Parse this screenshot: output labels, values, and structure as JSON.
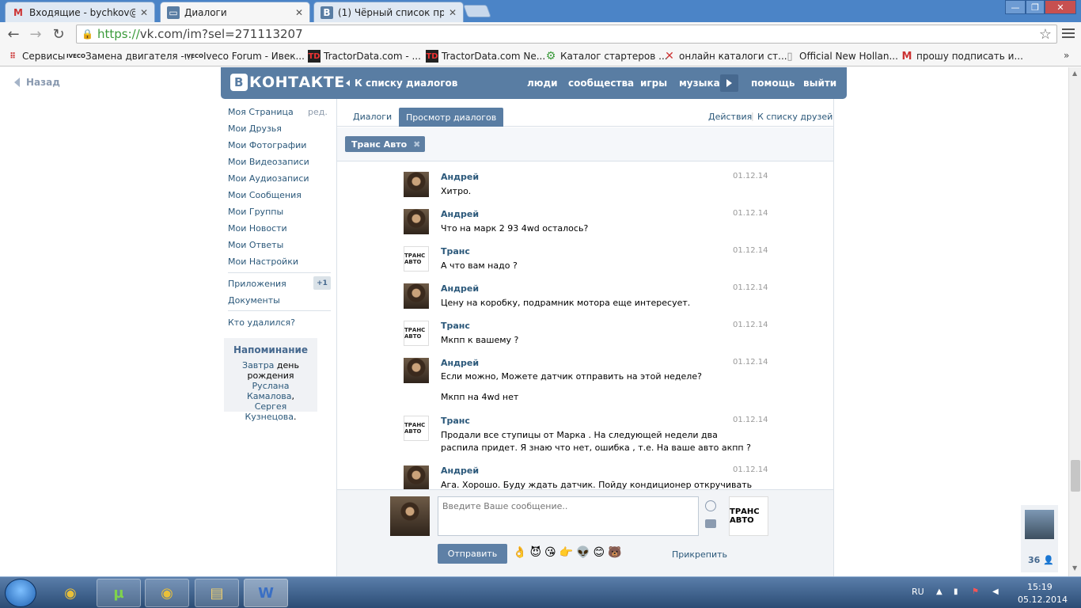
{
  "browser": {
    "tabs": [
      {
        "icon": "gmail-icon",
        "title": "Входящие - bychkov@spe"
      },
      {
        "icon": "vk-dialog-icon",
        "title": "Диалоги"
      },
      {
        "icon": "vk-icon",
        "title": "(1) Чёрный список прод"
      }
    ],
    "window_buttons": {
      "minimize": "—",
      "restore": "❐",
      "close": "✕"
    },
    "url_scheme": "https://",
    "url_rest": "vk.com/im?sel=271113207",
    "bookmarks": [
      "Сервисы",
      "Замена двигателя -...",
      "Iveco Forum - Ивек...",
      "TractorData.com - ...",
      "TractorData.com Ne...",
      "Каталог стартеров ...",
      "онлайн каталоги ст...",
      "Official New Hollan...",
      "прошу подписать и..."
    ],
    "bookmarks_more": "»"
  },
  "page": {
    "back_label": "Назад",
    "vk": {
      "logo_letter": "В",
      "logo_text": "КОНТАКТЕ",
      "back_to_dialogs": "К списку диалогов",
      "nav": [
        "люди",
        "сообщества",
        "игры",
        "музыка",
        "помощь",
        "выйти"
      ]
    },
    "left_menu": {
      "edit": "ред.",
      "items": [
        "Моя Страница",
        "Мои Друзья",
        "Мои Фотографии",
        "Мои Видеозаписи",
        "Мои Аудиозаписи",
        "Мои Сообщения",
        "Мои Группы",
        "Мои Новости",
        "Мои Ответы",
        "Мои Настройки"
      ],
      "apps": "Приложения",
      "apps_badge": "+1",
      "documents": "Документы",
      "who_deleted": "Кто удалился?",
      "reminder": {
        "title": "Напоминание",
        "w1": "Завтра",
        "w2": " день рождения ",
        "w3": "Руслана Камалова",
        "w4": ", ",
        "w5": "Сергея Кузнецова",
        "w6": "."
      }
    },
    "dialog": {
      "tab_dialogs": "Диалоги",
      "tab_view": "Просмотр диалогов",
      "actions": "Действия",
      "separator": "|",
      "friends_list": "К списку друзей",
      "peer": "Транс Авто",
      "peer_close": "✖",
      "messages": [
        {
          "author": "Андрей",
          "text": "Хитро.",
          "date": "01.12.14",
          "avatar": "person"
        },
        {
          "author": "Андрей",
          "text": "Что на марк 2 93 4wd осталось?",
          "date": "01.12.14",
          "avatar": "person"
        },
        {
          "author": "Транс",
          "text": "А что вам надо ?",
          "date": "01.12.14",
          "avatar": "logo"
        },
        {
          "author": "Андрей",
          "text": "Цену на коробку, подрамник мотора еще интересует.",
          "date": "01.12.14",
          "avatar": "person"
        },
        {
          "author": "Транс",
          "text": "Мкпп к вашему ?",
          "date": "01.12.14",
          "avatar": "logo"
        },
        {
          "author": "Андрей",
          "text": "Если можно, Можете датчик отправить на этой неделе?\n\nМкпп на 4wd нет",
          "date": "01.12.14",
          "avatar": "person"
        },
        {
          "author": "Транс",
          "text": "Продали все ступицы от Марка . На следующей недели два\nраспила придет. Я знаю что нет, ошибка , т.е. На ваше авто акпп ?",
          "date": "01.12.14",
          "avatar": "logo"
        },
        {
          "author": "Андрей",
          "text": "Ага. Хорошо. Буду ждать датчик. Пойду кондиционер откручивать",
          "date": "01.12.14",
          "avatar": "person"
        }
      ],
      "logo_avatar_text": "ТРАНС АВТО",
      "input_placeholder": "Введите Ваше сообщение..",
      "send": "Отправить",
      "emojis": [
        "👌",
        "😈",
        "😘",
        "👉",
        "👽",
        "😊",
        "🐻"
      ],
      "attach": "Прикрепить"
    },
    "right_widget": {
      "count": "36 👤"
    }
  },
  "taskbar": {
    "apps": [
      {
        "icon": "chrome-icon",
        "glyph": "◉"
      },
      {
        "icon": "utorrent-icon",
        "glyph": "µ"
      },
      {
        "icon": "chrome-icon",
        "glyph": "◉"
      },
      {
        "icon": "explorer-icon",
        "glyph": "▤"
      },
      {
        "icon": "word-icon",
        "glyph": "W"
      }
    ],
    "lang": "RU",
    "time": "15:19",
    "date": "05.12.2014"
  },
  "colors": {
    "vk_blue": "#597da3",
    "link": "#2b587a",
    "taskbar": "#2b4c75"
  }
}
